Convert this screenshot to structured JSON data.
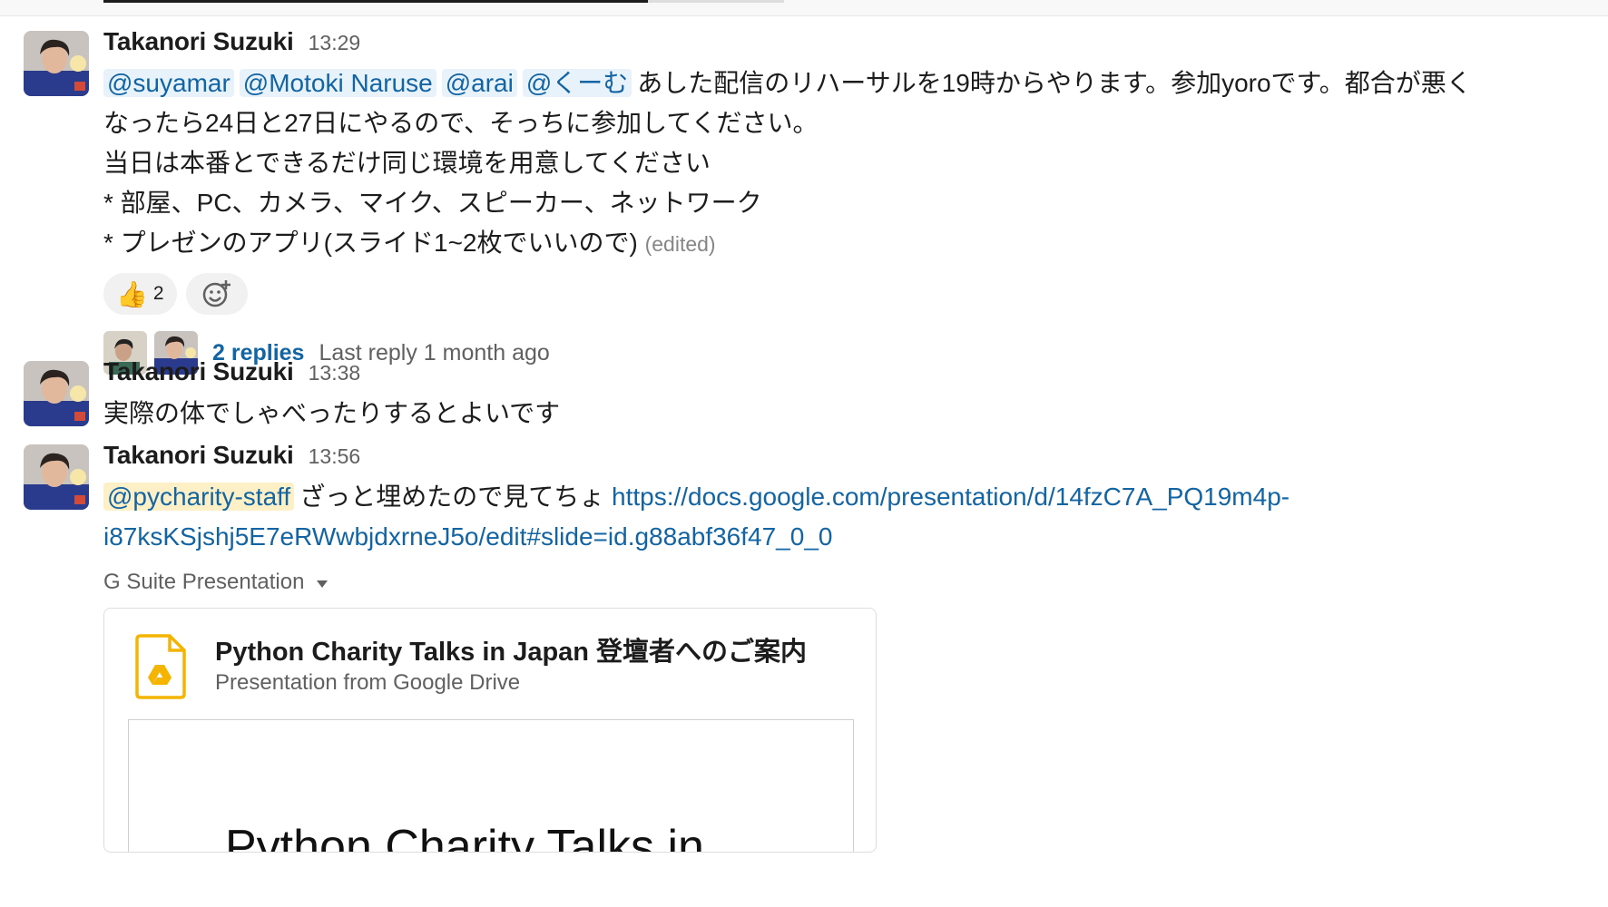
{
  "messages": [
    {
      "author": "Takanori Suzuki",
      "time": "13:29",
      "mentions": [
        "@suyamar",
        "@Motoki Naruse",
        "@arai",
        "@くーむ"
      ],
      "line1_text": "あした配信のリハーサルを19時からやります。参加yoroです。都合が悪く",
      "line2": "なったら24日と27日にやるので、そっちに参加してください。",
      "line3": "当日は本番とできるだけ同じ環境を用意してください",
      "line4": "* 部屋、PC、カメラ、マイク、スピーカー、ネットワーク",
      "line5": "* プレゼンのアプリ(スライド1~2枚でいいので)",
      "edited": "(edited)",
      "reaction": {
        "icon": "thumbs-up-icon",
        "count": "2"
      },
      "add_reaction_icon": "add-reaction-icon",
      "replies": {
        "count_label": "2 replies",
        "last_reply": "Last reply 1 month ago"
      }
    },
    {
      "author": "Takanori Suzuki",
      "time": "13:38",
      "text": "実際の体でしゃべったりするとよいです"
    },
    {
      "author": "Takanori Suzuki",
      "time": "13:56",
      "mention": "@pycharity-staff",
      "text": "ざっと埋めたので見てちょ",
      "link_line1": "https://docs.google.com/presentation/d/14fzC7A_PQ19m4p-",
      "link_line2": "i87ksKSjshj5E7eRWwbjdxrneJ5o/edit#slide=id.g88abf36f47_0_0",
      "attachment": {
        "label": "G Suite Presentation",
        "title": "Python Charity Talks in Japan 登壇者へのご案内",
        "subtitle": "Presentation from Google Drive",
        "preview_text": "Python Charity Talks in"
      }
    }
  ],
  "colors": {
    "link": "#1264a3",
    "mention_bg": "#e8f2fa",
    "group_mention_bg": "#fdf0c7",
    "drive_icon": "#f4b400"
  }
}
